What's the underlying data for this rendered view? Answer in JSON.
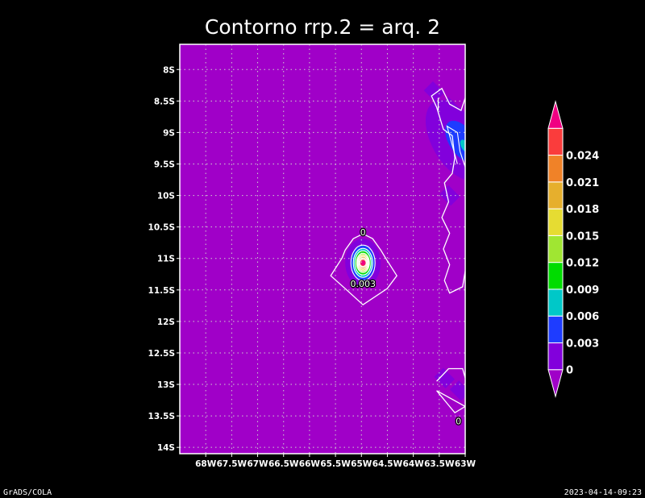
{
  "title": "Contorno rrp.2 = arq. 2",
  "footer": {
    "left": "GrADS/COLA",
    "right": "2023-04-14-09:23"
  },
  "chart_data": {
    "type": "heatmap",
    "title": "Contorno rrp.2 = arq. 2",
    "xlabel": "",
    "ylabel": "",
    "xlim": [
      -68.5,
      -63.0
    ],
    "ylim": [
      -14.1,
      -7.6
    ],
    "grid": true,
    "x_ticks": [
      {
        "value": -68.0,
        "label": "68W"
      },
      {
        "value": -67.5,
        "label": "67.5W"
      },
      {
        "value": -67.0,
        "label": "67W"
      },
      {
        "value": -66.5,
        "label": "66.5W"
      },
      {
        "value": -66.0,
        "label": "66W"
      },
      {
        "value": -65.5,
        "label": "65.5W"
      },
      {
        "value": -65.0,
        "label": "65W"
      },
      {
        "value": -64.5,
        "label": "64.5W"
      },
      {
        "value": -64.0,
        "label": "64W"
      },
      {
        "value": -63.5,
        "label": "63.5W"
      },
      {
        "value": -63.0,
        "label": "63W"
      }
    ],
    "y_ticks": [
      {
        "value": -8.0,
        "label": "8S"
      },
      {
        "value": -8.5,
        "label": "8.5S"
      },
      {
        "value": -9.0,
        "label": "9S"
      },
      {
        "value": -9.5,
        "label": "9.5S"
      },
      {
        "value": -10.0,
        "label": "10S"
      },
      {
        "value": -10.5,
        "label": "10.5S"
      },
      {
        "value": -11.0,
        "label": "11S"
      },
      {
        "value": -11.5,
        "label": "11.5S"
      },
      {
        "value": -12.0,
        "label": "12S"
      },
      {
        "value": -12.5,
        "label": "12.5S"
      },
      {
        "value": -13.0,
        "label": "13S"
      },
      {
        "value": -13.5,
        "label": "13.5S"
      },
      {
        "value": -14.0,
        "label": "14S"
      }
    ],
    "background_color": "#a000c8",
    "colorbar": {
      "levels": [
        "0",
        "0.003",
        "0.006",
        "0.009",
        "0.012",
        "0.015",
        "0.018",
        "0.021",
        "0.024"
      ],
      "colors": [
        "#a000c8",
        "#8200dc",
        "#1e3cff",
        "#00c8c8",
        "#00dc00",
        "#a0e632",
        "#e6dc32",
        "#e6af2d",
        "#f08228",
        "#fa3c3c",
        "#f00082"
      ]
    },
    "contour_labels": [
      {
        "text": "0",
        "x": -64.97,
        "y": -10.58
      },
      {
        "text": "0.003",
        "x": -64.97,
        "y": -11.4
      },
      {
        "text": "0",
        "x": -63.13,
        "y": -13.58
      }
    ],
    "features": [
      {
        "name": "isolated maximum",
        "center": [
          -64.97,
          -11.07
        ],
        "peak": 0.024
      },
      {
        "name": "east-edge band",
        "x_range": [
          -63.5,
          -63.0
        ],
        "y_range": [
          -8.4,
          -9.6
        ],
        "peak": 0.006
      }
    ]
  }
}
